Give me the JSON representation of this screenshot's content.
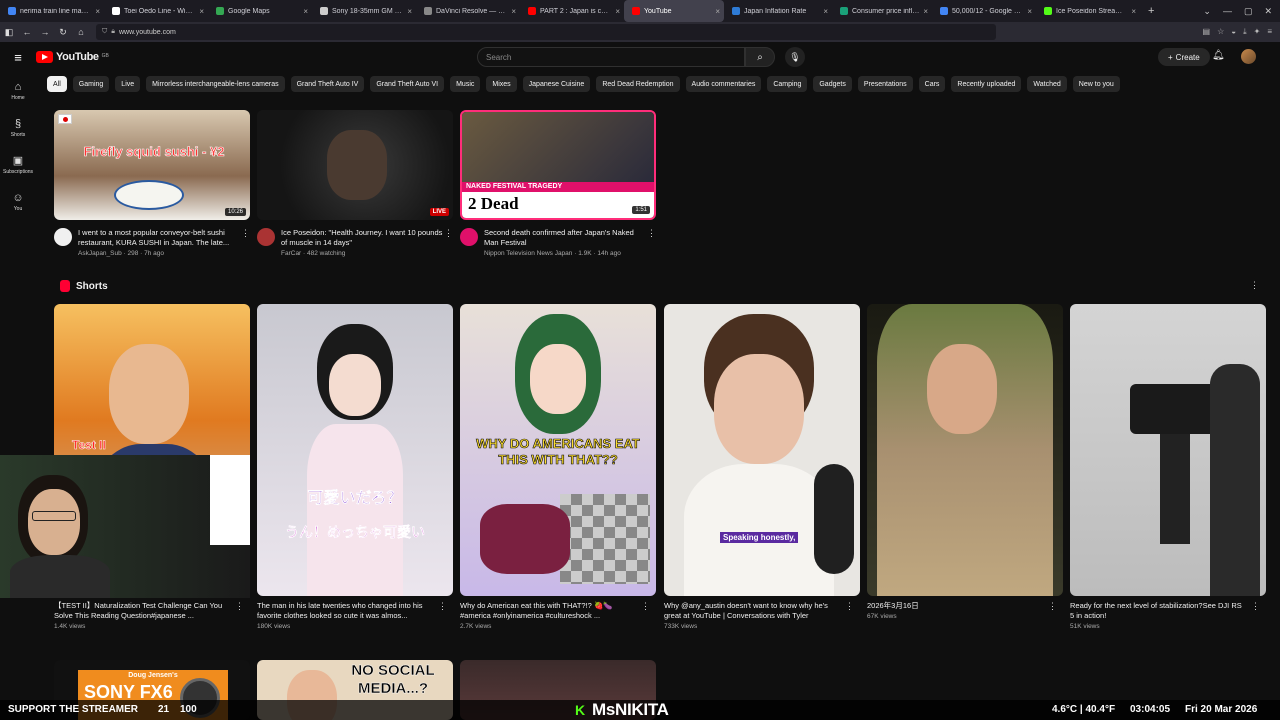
{
  "browser": {
    "tabs": [
      {
        "title": "nerima train line map - Goo",
        "color": "#4285f4"
      },
      {
        "title": "Toei Ōedo Line - Wikipedia",
        "color": "#ffffff"
      },
      {
        "title": "Google Maps",
        "color": "#34a853"
      },
      {
        "title": "Sony 18-35mm GM Lens - G",
        "color": "#cccccc"
      },
      {
        "title": "DaVinci Resolve — MotionVF",
        "color": "#888888"
      },
      {
        "title": "PART 2 : Japan is currently",
        "color": "#ff0000"
      },
      {
        "title": "YouTube",
        "color": "#ff0000",
        "active": true
      },
      {
        "title": "Japan Inflation Rate",
        "color": "#2e7bd6"
      },
      {
        "title": "Consumer price inflation, UK",
        "color": "#1aa179"
      },
      {
        "title": "50,000/12 - Google Search",
        "color": "#4285f4"
      },
      {
        "title": "Ice Poseidon Stream - Watch",
        "color": "#53fc18"
      }
    ],
    "url": "www.youtube.com",
    "new_tab": "+",
    "window_controls": [
      "⌄",
      "—",
      "▢",
      "✕"
    ]
  },
  "header": {
    "logo_text": "YouTube",
    "country": "GB",
    "search_placeholder": "Search",
    "create_label": "Create"
  },
  "sidebar": [
    {
      "label": "Home",
      "icon": "⌂"
    },
    {
      "label": "Shorts",
      "icon": "§"
    },
    {
      "label": "Subscriptions",
      "icon": "▣"
    },
    {
      "label": "You",
      "icon": "☺"
    }
  ],
  "chips": [
    "All",
    "Gaming",
    "Live",
    "Mirrorless interchangeable-lens cameras",
    "Grand Theft Auto IV",
    "Grand Theft Auto VI",
    "Music",
    "Mixes",
    "Japanese Cuisine",
    "Red Dead Redemption",
    "Audio commentaries",
    "Camping",
    "Gadgets",
    "Presentations",
    "Cars",
    "Recently uploaded",
    "Watched",
    "New to you"
  ],
  "videos": [
    {
      "title": "I went to a most popular conveyor-belt sushi restaurant, KURA SUSHI in Japan. The late...",
      "channel": "AskJapan_Sub",
      "meta": "298 · 7h ago",
      "duration": "10:26",
      "overlay": "Firefly squid sushi - ¥2",
      "thumb_bg": "#c8b8a2"
    },
    {
      "title": "Ice Poseidon: \"Health Journey. I want 10 pounds of muscle in 14 days\"",
      "channel": "FarCar",
      "meta": "482 watching",
      "duration": "LIVE",
      "overlay": "",
      "thumb_bg": "#1c1c1c"
    },
    {
      "title": "Second death confirmed after Japan's Naked Man Festival",
      "channel": "Nippon Television News Japan",
      "meta": "1.9K · 14h ago",
      "duration": "1:51",
      "overlay": "2 Dead",
      "overlay_top": "NAKED FESTIVAL TRAGEDY",
      "thumb_bg": "#2a2a3a"
    }
  ],
  "shorts_title": "Shorts",
  "shorts": [
    {
      "title": "【TEST II】Naturalization Test Challenge Can You Solve This Reading Question#japanese ...",
      "views": "1.4K views",
      "bg": "#e8a040",
      "overlay": "Test II"
    },
    {
      "title": "The man in his late twenties who changed into his favorite clothes looked so cute it was almos...",
      "views": "180K views",
      "bg": "#e9e4ea",
      "overlay": "可愛いだろ？",
      "overlay2": "うん！めっちゃ可愛い"
    },
    {
      "title": "Why do American eat this with THAT?!? 🍓🍆 #america #onlyinamerica  #cultureshock ...",
      "views": "2.7K views",
      "bg": "#d8d0c8",
      "overlay": "WHY DO AMERICANS EAT THIS WITH THAT??"
    },
    {
      "title": "Why @any_austin doesn't want to know why he's great at YouTube | Conversations with Tyler",
      "views": "733K views",
      "bg": "#e6e4e0",
      "overlay": "Speaking honestly,"
    },
    {
      "title": "2026年3月16日",
      "views": "67K views",
      "bg": "#2a2a22",
      "overlay": ""
    },
    {
      "title": "Ready for the next level of stabilization?See DJI RS 5 in action!",
      "views": "51K views",
      "bg": "#cfcfcf",
      "overlay": ""
    }
  ],
  "row3": [
    {
      "overlay_top": "Doug Jensen's",
      "overlay": "SONY FX6",
      "bg": "#f08c1e"
    },
    {
      "overlay": "NO SOCIAL MEDIA...?",
      "bg": "#e8d8c0"
    },
    {
      "overlay": "",
      "bg": "#3a2a2a"
    }
  ],
  "stream_overlay": {
    "support": "SUPPORT THE STREAMER",
    "count1": "21",
    "count2": "100",
    "streamer_name": "MsNIKITA",
    "kick_logo": "K",
    "temperature": "4.6°C | 40.4°F",
    "time": "03:04:05",
    "date": "Fri 20 Mar 2026"
  }
}
